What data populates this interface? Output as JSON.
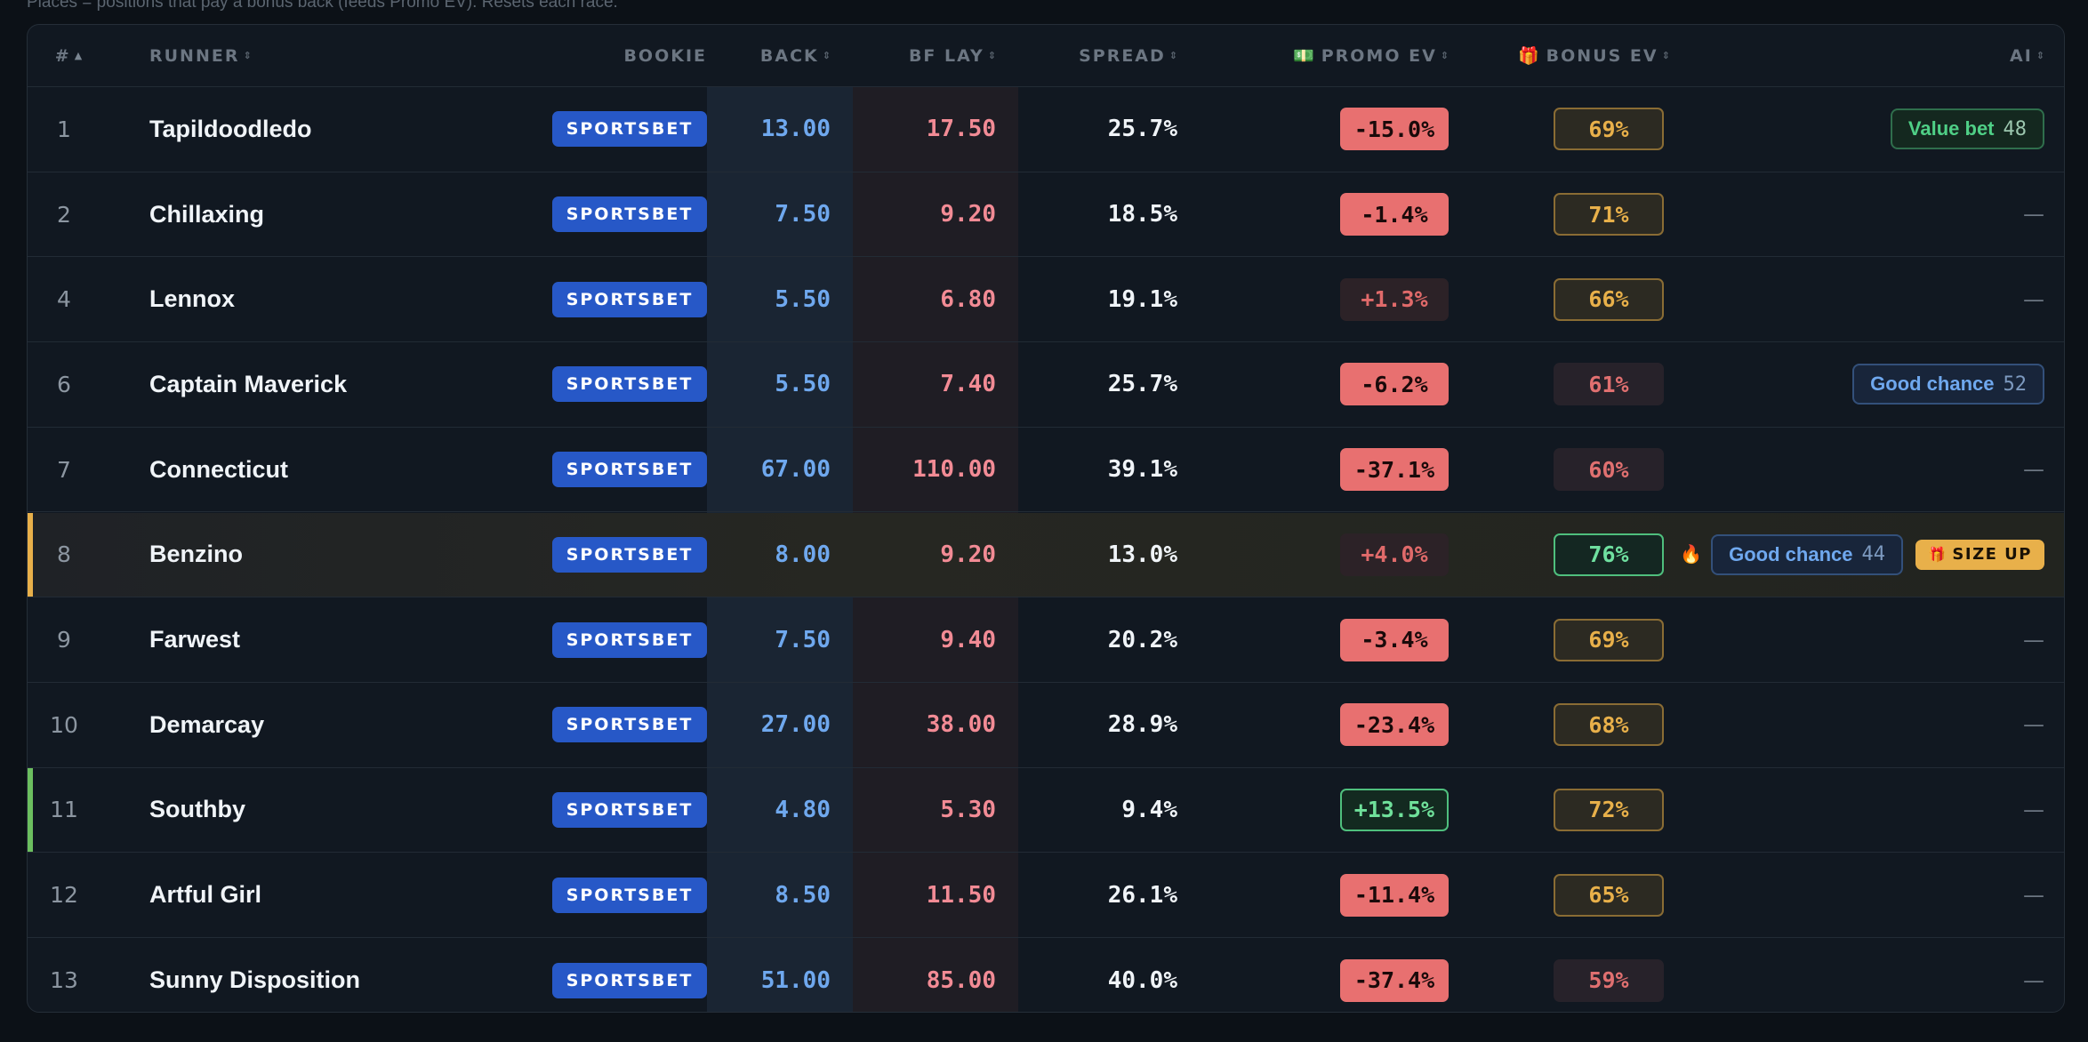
{
  "caption": "Places = positions that pay a bonus back (feeds Promo EV). Resets each race.",
  "colors": {
    "accent_highlight": "#e8b04a",
    "accent_value": "#6cbf5f",
    "bookie_bg": "#2758c7",
    "back_text": "#6fa8ee",
    "lay_text": "#f28b95"
  },
  "header": {
    "num": "#",
    "runner": "RUNNER",
    "bookie": "BOOKIE",
    "back": "BACK",
    "lay": "BF LAY",
    "spread": "SPREAD",
    "promo_ev": "PROMO EV",
    "promo_icon": "💵",
    "bonus_ev": "BONUS EV",
    "bonus_icon": "🎁",
    "ai": "AI",
    "sort_active": "▲",
    "sort_idle": "⇕"
  },
  "rows": [
    {
      "num": "1",
      "runner": "Tapildoodledo",
      "bookie": "SPORTSBET",
      "back": "13.00",
      "lay": "17.50",
      "spread": "25.7%",
      "promo": "-15.0%",
      "promo_style": "red",
      "bonus": "69%",
      "bonus_style": "gold",
      "ai": {
        "label": "Value bet",
        "score": "48",
        "style": "value"
      }
    },
    {
      "num": "2",
      "runner": "Chillaxing",
      "bookie": "SPORTSBET",
      "back": "7.50",
      "lay": "9.20",
      "spread": "18.5%",
      "promo": "-1.4%",
      "promo_style": "red",
      "bonus": "71%",
      "bonus_style": "gold",
      "ai": null
    },
    {
      "num": "4",
      "runner": "Lennox",
      "bookie": "SPORTSBET",
      "back": "5.50",
      "lay": "6.80",
      "spread": "19.1%",
      "promo": "+1.3%",
      "promo_style": "dim",
      "bonus": "66%",
      "bonus_style": "gold",
      "ai": null
    },
    {
      "num": "6",
      "runner": "Captain Maverick",
      "bookie": "SPORTSBET",
      "back": "5.50",
      "lay": "7.40",
      "spread": "25.7%",
      "promo": "-6.2%",
      "promo_style": "red",
      "bonus": "61%",
      "bonus_style": "dim",
      "ai": {
        "label": "Good chance",
        "score": "52",
        "style": "good"
      }
    },
    {
      "num": "7",
      "runner": "Connecticut",
      "bookie": "SPORTSBET",
      "back": "67.00",
      "lay": "110.00",
      "spread": "39.1%",
      "promo": "-37.1%",
      "promo_style": "red",
      "bonus": "60%",
      "bonus_style": "dim",
      "ai": null
    },
    {
      "num": "8",
      "runner": "Benzino",
      "bookie": "SPORTSBET",
      "back": "8.00",
      "lay": "9.20",
      "spread": "13.0%",
      "promo": "+4.0%",
      "promo_style": "dim",
      "bonus": "76%",
      "bonus_style": "green",
      "flame": true,
      "highlight": "gold",
      "ai": {
        "label": "Good chance",
        "score": "44",
        "style": "good",
        "size_up": "SIZE UP"
      }
    },
    {
      "num": "9",
      "runner": "Farwest",
      "bookie": "SPORTSBET",
      "back": "7.50",
      "lay": "9.40",
      "spread": "20.2%",
      "promo": "-3.4%",
      "promo_style": "red",
      "bonus": "69%",
      "bonus_style": "gold",
      "ai": null
    },
    {
      "num": "10",
      "runner": "Demarcay",
      "bookie": "SPORTSBET",
      "back": "27.00",
      "lay": "38.00",
      "spread": "28.9%",
      "promo": "-23.4%",
      "promo_style": "red",
      "bonus": "68%",
      "bonus_style": "gold",
      "ai": null
    },
    {
      "num": "11",
      "runner": "Southby",
      "bookie": "SPORTSBET",
      "back": "4.80",
      "lay": "5.30",
      "spread": "9.4%",
      "promo": "+13.5%",
      "promo_style": "green",
      "bonus": "72%",
      "bonus_style": "gold",
      "accent": "green",
      "ai": null
    },
    {
      "num": "12",
      "runner": "Artful Girl",
      "bookie": "SPORTSBET",
      "back": "8.50",
      "lay": "11.50",
      "spread": "26.1%",
      "promo": "-11.4%",
      "promo_style": "red",
      "bonus": "65%",
      "bonus_style": "gold",
      "ai": null
    },
    {
      "num": "13",
      "runner": "Sunny Disposition",
      "bookie": "SPORTSBET",
      "back": "51.00",
      "lay": "85.00",
      "spread": "40.0%",
      "promo": "-37.4%",
      "promo_style": "red",
      "bonus": "59%",
      "bonus_style": "dim",
      "ai": null
    }
  ],
  "empty_ai": "—",
  "flame_icon": "🔥",
  "gift_icon": "🎁"
}
